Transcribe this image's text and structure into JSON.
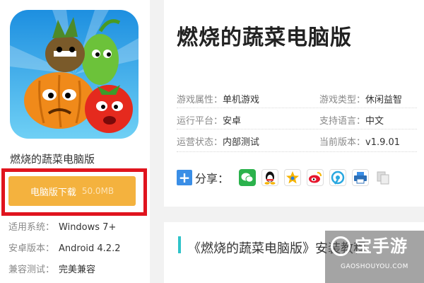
{
  "app": {
    "name": "燃烧的蔬菜电脑版",
    "title": "燃烧的蔬菜电脑版",
    "download_label": "电脑版下载",
    "download_size": "50.0MB"
  },
  "left_info": [
    {
      "label": "适用系统：",
      "value": "Windows 7+"
    },
    {
      "label": "安卓版本：",
      "value": "Android 4.2.2"
    },
    {
      "label": "兼容测试：",
      "value": "完美兼容"
    }
  ],
  "attributes": {
    "type_attr": {
      "label": "游戏属性：",
      "value": "单机游戏"
    },
    "game_type": {
      "label": "游戏类型：",
      "value": "休闲益智"
    },
    "platform": {
      "label": "运行平台：",
      "value": "安卓"
    },
    "language": {
      "label": "支持语言：",
      "value": "中文"
    },
    "status": {
      "label": "运营状态：",
      "value": "内部测试"
    },
    "version": {
      "label": "当前版本：",
      "value": "v1.9.01"
    }
  },
  "share": {
    "label": "分享：",
    "icons": [
      "wechat-icon",
      "qq-icon",
      "qzone-icon",
      "weibo-icon",
      "tencent-weibo-icon",
      "print-icon",
      "copy-icon"
    ]
  },
  "install_title": "《燃烧的蔬菜电脑版》安装教程",
  "watermark": {
    "text": "宝手游",
    "sub": "GAOSHOUYOU.COM"
  },
  "colors": {
    "download": "#f4b23e",
    "highlight_frame": "#e0141e",
    "accent_bar": "#2fc3c9",
    "share_plus": "#3a8ee6"
  }
}
